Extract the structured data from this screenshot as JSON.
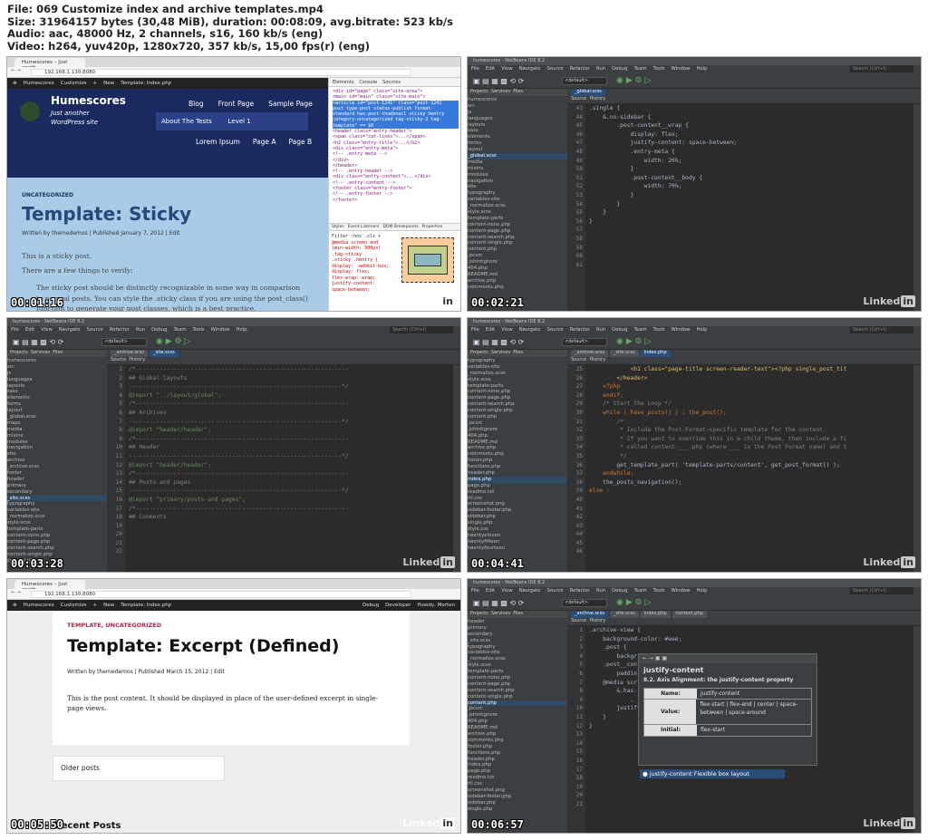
{
  "header": {
    "lines": [
      "File: 069 Customize index and archive templates.mp4",
      "Size: 31964157 bytes (30,48 MiB), duration: 00:08:09, avg.bitrate: 523 kb/s",
      "Audio: aac, 48000 Hz, 2 channels, s16, 160 kb/s (eng)",
      "Video: h264, yuv420p, 1280x720, 357 kb/s, 15,00 fps(r) (eng)"
    ]
  },
  "brand": {
    "li": "Linked",
    "in": "in"
  },
  "browser": {
    "tab": "Humescores – Just anoth...",
    "url": "192.168.1.130:8080",
    "adminbar": [
      "Humescores",
      "Customize",
      "+",
      "New",
      "Template: Index.php"
    ],
    "adminright": [
      "Debug",
      "Developer",
      "Howdy, Morten"
    ]
  },
  "ide": {
    "title": "humescores - NetBeans IDE 8.2",
    "menu": [
      "File",
      "Edit",
      "View",
      "Navigate",
      "Source",
      "Refactor",
      "Run",
      "Debug",
      "Team",
      "Tools",
      "Window",
      "Help"
    ],
    "search": "Search (Ctrl+I)",
    "config": "<default>",
    "panels": [
      "Projects",
      "Services",
      "Files"
    ],
    "srcTab": "Source",
    "histTab": "History"
  },
  "tiles": [
    {
      "time": "00:01:16",
      "site": {
        "title": "Humescores",
        "tagline": "Just another WordPress site",
        "nav": [
          "Blog",
          "Front Page",
          "Sample Page"
        ],
        "nav2": [
          "About The Tests",
          "Level 1"
        ],
        "nav3": [
          "Lorem Ipsum",
          "Page A",
          "Page B"
        ],
        "category": "UNCATEGORIZED",
        "postTitle": "Template: Sticky",
        "meta": "Written by themedemos | Published January 7, 2012 | Edit",
        "p1": "This is a sticky post.",
        "p2": "There are a few things to verify:",
        "bullet": "The sticky post should be distinctly recognizable in some way in comparison to normal posts. You can style the .sticky class if you are using the post_class() function to generate your post classes, which is a best practice."
      },
      "devtools": {
        "tabs": [
          "Elements",
          "Console",
          "Sources"
        ],
        "subtabs": [
          "Styles",
          "Event Listeners",
          "DOM Breakpoints",
          "Properties"
        ],
        "html": [
          "<div id=\"page\" class=\"site-area\">",
          "<main id=\"main\" class=\"site-main\">",
          "<article id=\"post-1241\" class=\"post-1241",
          "post type-post status-publish format-",
          "standard has-post-thumbnail sticky hentry",
          "category-uncategorized tag-sticky-2 tag-",
          "template\" == $0",
          "<header class=\"entry-header\">",
          "<span class=\"cat-links\">...</span>",
          "<h2 class=\"entry-title\">...</h2>",
          "<div class=\"entry-meta\">",
          "<!-- .entry-meta -->",
          "</div>",
          "</header>",
          "<!-- .entry-header -->",
          "<div class=\"entry-content\">...</div>",
          "<!-- .entry-content -->",
          "<footer class=\"entry-footer\">",
          "<!-- .entry-footer -->",
          "</footer>"
        ],
        "styles": [
          "Filter     :hov  .cls  +",
          "@media screen and",
          "(min-width: 900px)",
          "  .tag-sticky",
          ".sticky .hentry {",
          "  display: -webkit-box;",
          "  display: flex;",
          "  flex-wrap: wrap;",
          "  justify-content:",
          "    space-between;"
        ]
      }
    },
    {
      "time": "00:02:21",
      "tabs": [
        "_global.scss"
      ],
      "tree": [
        "humescores",
        "  src",
        "  js",
        "  languages",
        "  layouts",
        "  sass",
        "    elements",
        "    forms",
        "    layout",
        "      _global.scss",
        "    media",
        "    mixins",
        "    modules",
        "    navigation",
        "    site",
        "    typography",
        "    variables-site",
        "    _normalize.scss",
        "    style.scss",
        "  template-parts",
        "    content-none.php",
        "    content-page.php",
        "    content-search.php",
        "    content-single.php",
        "    content.php",
        "  .jscsrc",
        "  .jshintignore",
        "  404.php",
        "  README.md",
        "  archive.php",
        "  comments.php"
      ],
      "gutter": [
        "43",
        "44",
        "45",
        "46",
        "47",
        "48",
        "49",
        "50",
        "51",
        "52",
        "53",
        "54",
        "55",
        "56",
        "57",
        "58",
        "59",
        "60",
        "61"
      ],
      "code": [
        ".single {",
        "    &.no-sidebar {",
        "",
        "",
        "        .post-content__wrap {",
        "            display: flex;",
        "            justify-content: space-between;",
        "",
        "            .entry-meta {",
        "                width: 20%;",
        "            }",
        "",
        "            .post-content__body {",
        "                width: 70%;",
        "            }",
        "        }",
        "",
        "    }",
        "}"
      ]
    },
    {
      "time": "00:03:28",
      "tabs": [
        "_archive.scss",
        "_site.scss"
      ],
      "tree": [
        "humescores",
        "  src",
        "  js",
        "  languages",
        "  layouts",
        "  sass",
        "    elements",
        "    forms",
        "    layout",
        "      _global.scss",
        "    maps",
        "    media",
        "    mixins",
        "    modules",
        "    navigation",
        "    site",
        "      archive",
        "        _archive.scss",
        "      footer",
        "      header",
        "      primary",
        "      secondary",
        "      _site.scss",
        "    typography",
        "    variables-site",
        "    _normalize.scss",
        "    style.scss",
        "  template-parts",
        "    content-none.php",
        "    content-page.php",
        "    content-search.php",
        "    content-single.php",
        "    content.php"
      ],
      "gutter": [
        "1",
        "2",
        "3",
        "4",
        "5",
        "6",
        "7",
        "8",
        "9",
        "10",
        "11",
        "12",
        "13",
        "14",
        "15",
        "16",
        "17",
        "18",
        "19",
        "20",
        "21",
        "22"
      ],
      "code": [
        "/*--------------------------------------------------------------",
        "## Global layouts",
        "--------------------------------------------------------------*/",
        "@import \"../layout/global\";",
        "",
        "/*--------------------------------------------------------------",
        "## Archives",
        "--------------------------------------------------------------*/",
        "@import \"header/header\";",
        "",
        "/*--------------------------------------------------------------",
        "## Header",
        "--------------------------------------------------------------*/",
        "@import \"header/header\";",
        "",
        "/*--------------------------------------------------------------",
        "## Posts and pages",
        "--------------------------------------------------------------*/",
        "@import \"primary/posts-and-pages\";",
        "",
        "/*--------------------------------------------------------------",
        "## Comments"
      ]
    },
    {
      "time": "00:04:41",
      "tabs": [
        "_archive.scss",
        "_site.scss",
        "index.php"
      ],
      "tree": [
        "    typography",
        "    variables-site",
        "    _normalize.scss",
        "    style.scss",
        "  template-parts",
        "    content-none.php",
        "    content-page.php",
        "    content-search.php",
        "    content-single.php",
        "    content.php",
        "  .jscsrc",
        "  .jshintignore",
        "  404.php",
        "  README.md",
        "  archive.php",
        "  comments.php",
        "  footer.php",
        "  functions.php",
        "  header.php",
        "  index.php",
        "  page.php",
        "  readme.txt",
        "  rtl.css",
        "  screenshot.png",
        "  sidebar-footer.php",
        "  sidebar.php",
        "  single.php",
        "  style.css",
        "  twentyeleven",
        "  twentyfifteen",
        "  twentyfourteen"
      ],
      "gutter": [
        "25",
        "26",
        "27",
        "28",
        "29",
        "30",
        "31",
        "32",
        "33",
        "34",
        "35",
        "36",
        "37",
        "38",
        "39",
        "40",
        "41",
        "42",
        "43",
        "44",
        "45",
        "46"
      ],
      "code": [
        "            <h1 class=\"page-title screen-reader-text\"><?php single_post_tit",
        "        </header>",
        "",
        "",
        "    <?php",
        "    endif;",
        "",
        "    /* Start the Loop */",
        "    while ( have_posts() ) : the_post();",
        "",
        "        /*",
        "         * Include the Post-Format-specific template for the content.",
        "         * If you want to override this in a child theme, then include a fi",
        "         * called content-___.php (where ___ is the Post Format name) and t",
        "         */",
        "        get_template_part( 'template-parts/content', get_post_format() );",
        "",
        "    endwhile;",
        "",
        "    the_posts_navigation();",
        "",
        "else :"
      ]
    },
    {
      "time": "00:05:50",
      "post": {
        "category": "TEMPLATE, UNCATEGORIZED",
        "title": "Template: Excerpt (Defined)",
        "meta": "Written by themedemos | Published March 15, 2012 | Edit",
        "body": "This is the post content. It should be displayed in place of the user-defined excerpt in single-page views.",
        "older": "Older posts",
        "recent": "Recent Posts"
      }
    },
    {
      "time": "00:06:57",
      "tabs": [
        "_archive.scss",
        "_site.scss",
        "index.php",
        "content.php"
      ],
      "tree": [
        "      header",
        "      primary",
        "      secondary",
        "      _site.scss",
        "    typography",
        "    variables-site",
        "    _normalize.scss",
        "    style.scss",
        "  template-parts",
        "    content-none.php",
        "    content-page.php",
        "    content-search.php",
        "    content-single.php",
        "    content.php",
        "  .jscsrc",
        "  .jshintignore",
        "  404.php",
        "  README.md",
        "  archive.php",
        "  comments.php",
        "  footer.php",
        "  functions.php",
        "  header.php",
        "  index.php",
        "  page.php",
        "  readme.txt",
        "  rtl.css",
        "  screenshot.png",
        "  sidebar-footer.php",
        "  sidebar.php",
        "  single.php"
      ],
      "gutter": [
        "1",
        "2",
        "3",
        "4",
        "5",
        "6",
        "7",
        "8",
        "9",
        "10",
        "11",
        "12",
        "13",
        "14",
        "15",
        "16",
        "17",
        "18",
        "19",
        "20",
        "21"
      ],
      "code": [
        ".archive-view {",
        "    background-color: #eee;",
        "",
        "    .post {",
        "        backgr",
        "",
        "",
        "    .post__con",
        "        paddin",
        "",
        "",
        "    @media scr",
        "        &.has-",
        "            .",
        "",
        "",
        "",
        "",
        "        justify",
        "    } ",
        "}"
      ],
      "popup": {
        "title": "justify-content",
        "sub": "8.2. Axis Alignment: the justify-content property",
        "rows": [
          {
            "k": "Name:",
            "v": "justify-content"
          },
          {
            "k": "Value:",
            "v": "flex-start | flex-end | center | space-between | space-around"
          },
          {
            "k": "Initial:",
            "v": "flex-start"
          }
        ],
        "completion": "justify-content",
        "completionHint": "Flexible box layout"
      }
    }
  ]
}
